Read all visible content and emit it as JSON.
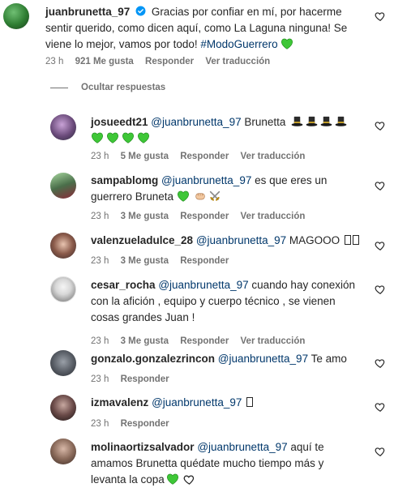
{
  "main_comment": {
    "username": "juanbrunetta_97",
    "verified_icon": "verified-badge-icon",
    "text": "Gracias por confiar en mí, por hacerme sentir querido, como dicen aquí, como La Laguna ninguna! Se viene lo mejor, vamos por todo!",
    "hashtag": "#ModoGuerrero",
    "time": "23 h",
    "likes": "921 Me gusta",
    "reply": "Responder",
    "translate": "Ver traducción"
  },
  "hide_replies": "Ocultar respuestas",
  "replies": [
    {
      "username": "josueedt21",
      "mention": "@juanbrunetta_97",
      "text": "Brunetta",
      "time": "23 h",
      "likes": "5 Me gusta",
      "reply": "Responder",
      "translate": "Ver traducción"
    },
    {
      "username": "sampablomg",
      "mention": "@juanbrunetta_97",
      "text": "es que eres un guerrero Bruneta",
      "time": "23 h",
      "likes": "3 Me gusta",
      "reply": "Responder",
      "translate": "Ver traducción"
    },
    {
      "username": "valenzueladulce_28",
      "mention": "@juanbrunetta_97",
      "text": "MAGOOO",
      "time": "23 h",
      "likes": "3 Me gusta",
      "reply": "Responder"
    },
    {
      "username": "cesar_rocha",
      "mention": "@juanbrunetta_97",
      "text_line1": "cuando hay conexión",
      "text_line2": "con la afición , equipo y cuerpo técnico , se vienen",
      "text_line3": "cosas grandes Juan !",
      "time": "23 h",
      "likes": "3 Me gusta",
      "reply": "Responder",
      "translate": "Ver traducción"
    },
    {
      "username": "gonzalo.gonzalezrincon",
      "mention": "@juanbrunetta_97",
      "text": "Te amo",
      "time": "23 h",
      "reply": "Responder"
    },
    {
      "username": "izmavalenz",
      "mention": "@juanbrunetta_97",
      "time": "23 h",
      "reply": "Responder"
    },
    {
      "username": "molinaortizsalvador",
      "mention": "@juanbrunetta_97",
      "text_line1": "aquí te",
      "text_line2": "amamos Brunetta quédate mucho tiempo más y",
      "text_line3": "levanta la copa"
    }
  ],
  "colors": {
    "mention": "#00376b",
    "meta": "#737373",
    "text": "#262626",
    "verified": "#0095f6",
    "green_heart": "#3ec737"
  }
}
